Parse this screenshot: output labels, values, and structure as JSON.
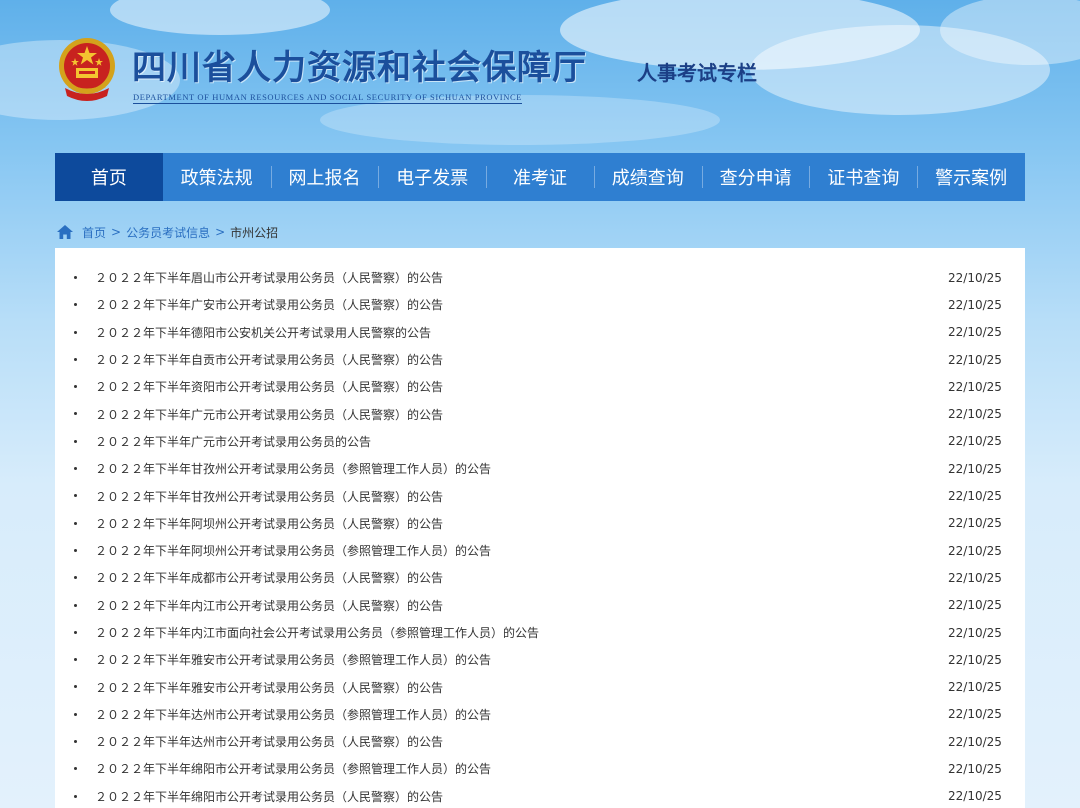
{
  "header": {
    "title": "四川省人力资源和社会保障厅",
    "subtitle": "DEPARTMENT OF HUMAN RESOURCES AND SOCIAL SECURITY OF SICHUAN PROVINCE",
    "column": "人事考试专栏"
  },
  "nav": {
    "active_color": "#0d4a9c",
    "bar_color": "#2f7fd1",
    "items": [
      {
        "label": "首页",
        "active": true
      },
      {
        "label": "政策法规"
      },
      {
        "label": "网上报名"
      },
      {
        "label": "电子发票"
      },
      {
        "label": "准考证"
      },
      {
        "label": "成绩查询"
      },
      {
        "label": "查分申请"
      },
      {
        "label": "证书查询"
      },
      {
        "label": "警示案例"
      }
    ]
  },
  "breadcrumb": {
    "home": "首页",
    "separator": ">",
    "level1": "公务员考试信息",
    "current": "市州公招"
  },
  "list": {
    "items": [
      {
        "title": "２０２２年下半年眉山市公开考试录用公务员（人民警察）的公告",
        "date": "22/10/25"
      },
      {
        "title": "２０２２年下半年广安市公开考试录用公务员（人民警察）的公告",
        "date": "22/10/25"
      },
      {
        "title": "２０２２年下半年德阳市公安机关公开考试录用人民警察的公告",
        "date": "22/10/25"
      },
      {
        "title": "２０２２年下半年自贡市公开考试录用公务员（人民警察）的公告",
        "date": "22/10/25"
      },
      {
        "title": "２０２２年下半年资阳市公开考试录用公务员（人民警察）的公告",
        "date": "22/10/25"
      },
      {
        "title": "２０２２年下半年广元市公开考试录用公务员（人民警察）的公告",
        "date": "22/10/25"
      },
      {
        "title": "２０２２年下半年广元市公开考试录用公务员的公告",
        "date": "22/10/25"
      },
      {
        "title": "２０２２年下半年甘孜州公开考试录用公务员（参照管理工作人员）的公告",
        "date": "22/10/25"
      },
      {
        "title": "２０２２年下半年甘孜州公开考试录用公务员（人民警察）的公告",
        "date": "22/10/25"
      },
      {
        "title": "２０２２年下半年阿坝州公开考试录用公务员（人民警察）的公告",
        "date": "22/10/25"
      },
      {
        "title": "２０２２年下半年阿坝州公开考试录用公务员（参照管理工作人员）的公告",
        "date": "22/10/25"
      },
      {
        "title": "２０２２年下半年成都市公开考试录用公务员（人民警察）的公告",
        "date": "22/10/25"
      },
      {
        "title": "２０２２年下半年内江市公开考试录用公务员（人民警察）的公告",
        "date": "22/10/25"
      },
      {
        "title": "２０２２年下半年内江市面向社会公开考试录用公务员（参照管理工作人员）的公告",
        "date": "22/10/25"
      },
      {
        "title": "２０２２年下半年雅安市公开考试录用公务员（参照管理工作人员）的公告",
        "date": "22/10/25"
      },
      {
        "title": "２０２２年下半年雅安市公开考试录用公务员（人民警察）的公告",
        "date": "22/10/25"
      },
      {
        "title": "２０２２年下半年达州市公开考试录用公务员（参照管理工作人员）的公告",
        "date": "22/10/25"
      },
      {
        "title": "２０２２年下半年达州市公开考试录用公务员（人民警察）的公告",
        "date": "22/10/25"
      },
      {
        "title": "２０２２年下半年绵阳市公开考试录用公务员（参照管理工作人员）的公告",
        "date": "22/10/25"
      },
      {
        "title": "２０２２年下半年绵阳市公开考试录用公务员（人民警察）的公告",
        "date": "22/10/25"
      }
    ]
  }
}
